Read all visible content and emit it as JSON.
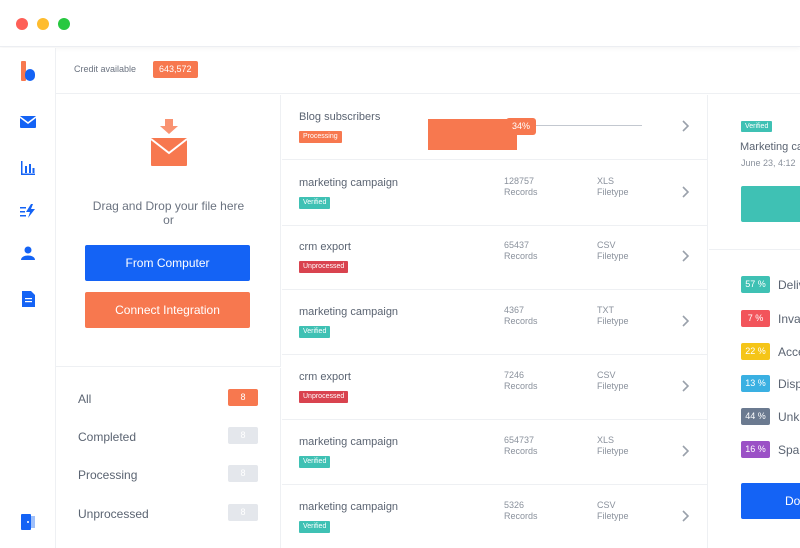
{
  "credit": {
    "label": "Credit available",
    "value": "643,572"
  },
  "upload": {
    "drag_text": "Drag and Drop your file here",
    "or_text": "or",
    "from_computer": "From Computer",
    "connect_integration": "Connect Integration"
  },
  "filters": [
    {
      "label": "All",
      "count": "8"
    },
    {
      "label": "Completed",
      "count": "8"
    },
    {
      "label": "Processing",
      "count": "8"
    },
    {
      "label": "Unprocessed",
      "count": "8"
    }
  ],
  "files": [
    {
      "name": "Blog subscribers",
      "status": "Processing",
      "progress": "34%"
    },
    {
      "name": "marketing campaign",
      "status": "Verified",
      "records": "128757",
      "records_label": "Records",
      "filetype": "XLS",
      "filetype_label": "Filetype"
    },
    {
      "name": "crm export",
      "status": "Unprocessed",
      "records": "65437",
      "records_label": "Records",
      "filetype": "CSV",
      "filetype_label": "Filetype"
    },
    {
      "name": "marketing campaign",
      "status": "Verified",
      "records": "4367",
      "records_label": "Records",
      "filetype": "TXT",
      "filetype_label": "Filetype"
    },
    {
      "name": "crm export",
      "status": "Unprocessed",
      "records": "7246",
      "records_label": "Records",
      "filetype": "CSV",
      "filetype_label": "Filetype"
    },
    {
      "name": "marketing campaign",
      "status": "Verified",
      "records": "654737",
      "records_label": "Records",
      "filetype": "XLS",
      "filetype_label": "Filetype"
    },
    {
      "name": "marketing campaign",
      "status": "Verified",
      "records": "5326",
      "records_label": "Records",
      "filetype": "CSV",
      "filetype_label": "Filetype"
    }
  ],
  "detail": {
    "status": "Verified",
    "name": "Marketing ca",
    "date": "June 23, 4:12",
    "stats": [
      {
        "percent": "57 %",
        "label": "Deliv",
        "color": "#3fc1b4"
      },
      {
        "percent": "7 %",
        "label": "Inva",
        "color": "#f2545b"
      },
      {
        "percent": "22 %",
        "label": "Acce",
        "color": "#f5c518"
      },
      {
        "percent": "13 %",
        "label": "Disp",
        "color": "#3ab0e2"
      },
      {
        "percent": "44 %",
        "label": "Unkn",
        "color": "#6b7a90"
      },
      {
        "percent": "16 %",
        "label": "Spar",
        "color": "#9b51c6"
      }
    ],
    "done_label": "Do"
  },
  "colors": {
    "accent_orange": "#f7784f",
    "primary_blue": "#1463f5",
    "verified_teal": "#3fc1b4",
    "unprocessed_red": "#d9434f"
  }
}
